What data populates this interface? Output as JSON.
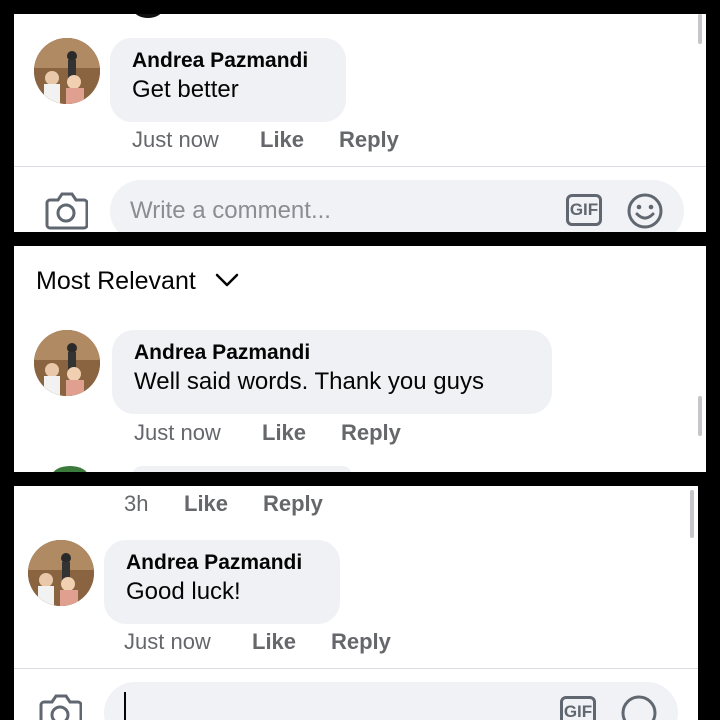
{
  "panel1": {
    "comment": {
      "author": "Andrea Pazmandi",
      "text": "Get better",
      "time": "Just now",
      "like": "Like",
      "reply": "Reply"
    },
    "composer": {
      "placeholder": "Write a comment...",
      "camera_icon": "camera-icon",
      "gif_label": "GIF",
      "emoji_icon": "emoji-icon"
    }
  },
  "panel2": {
    "sort": {
      "label": "Most Relevant",
      "icon": "chevron-down-icon"
    },
    "comment": {
      "author": "Andrea Pazmandi",
      "text": "Well said words.  Thank you guys",
      "time": "Just now",
      "like": "Like",
      "reply": "Reply"
    }
  },
  "panel3": {
    "previous_actions": {
      "time": "3h",
      "like": "Like",
      "reply": "Reply"
    },
    "comment": {
      "author": "Andrea Pazmandi",
      "text": "Good luck!",
      "time": "Just now",
      "like": "Like",
      "reply": "Reply"
    },
    "composer": {
      "camera_icon": "camera-icon",
      "gif_label": "GIF"
    }
  },
  "colors": {
    "bubble": "#eff1f4",
    "secondary_text": "#65676b",
    "background_frame": "#000000"
  }
}
